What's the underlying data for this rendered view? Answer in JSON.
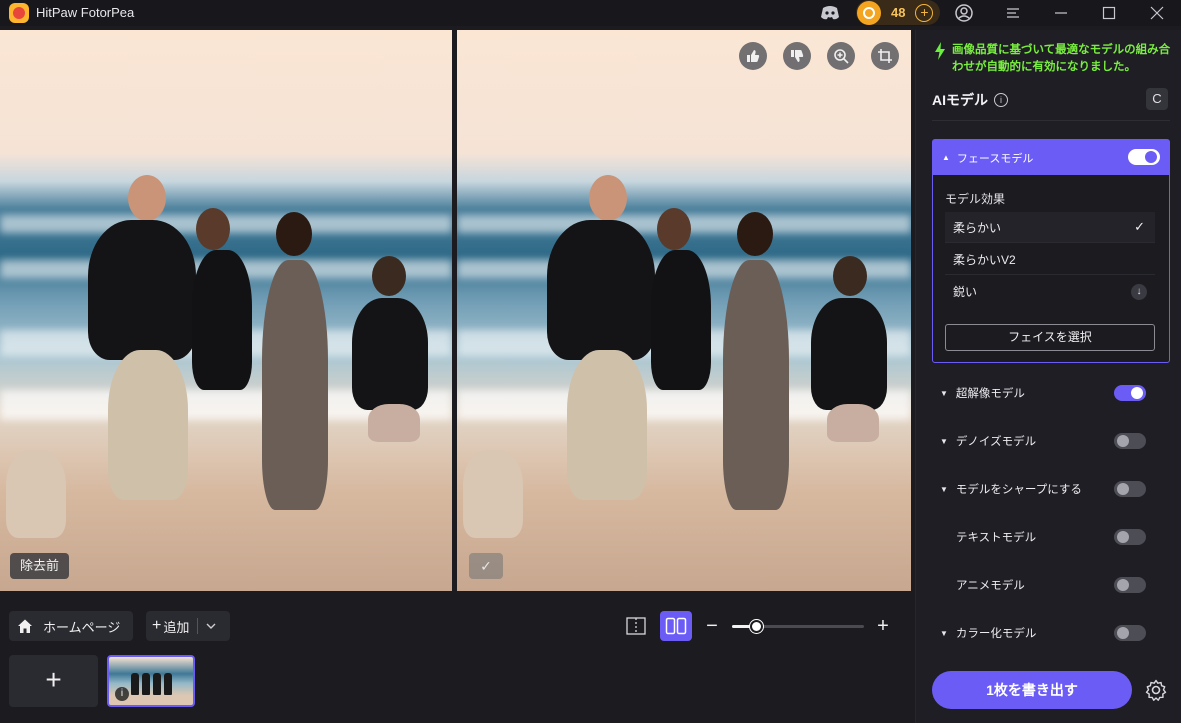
{
  "app": {
    "title": "HitPaw FotorPea",
    "coins": "48"
  },
  "titlebar_icons": [
    "discord-icon",
    "add-coins-icon",
    "account-icon",
    "menu-icon",
    "minimize-icon",
    "maximize-icon",
    "close-icon"
  ],
  "preview": {
    "left_label": "除去前",
    "right_label": "✓",
    "tools": [
      "thumbs-up-icon",
      "thumbs-down-icon",
      "zoom-in-icon",
      "crop-icon"
    ]
  },
  "bottom": {
    "home_label": "ホームページ",
    "add_label": "追加",
    "add_tile": "+",
    "zoom_minus": "−",
    "zoom_plus": "+",
    "zoom_level": 0.18
  },
  "panel": {
    "notice": "画像品質に基づいて最適なモデルの組み合わせが自動的に有効になりました。",
    "ai_title": "AIモデル",
    "reset_icon": "C",
    "face_model": {
      "label": "フェースモデル",
      "enabled": true,
      "effect_label": "モデル効果",
      "options": [
        {
          "label": "柔らかい",
          "selected": true
        },
        {
          "label": "柔らかいV2",
          "selected": false
        },
        {
          "label": "鋭い",
          "selected": false,
          "download": true
        }
      ],
      "select_face": "フェイスを選択"
    },
    "models": [
      {
        "label": "超解像モデル",
        "enabled": true,
        "collapsible": true
      },
      {
        "label": "デノイズモデル",
        "enabled": false,
        "collapsible": true
      },
      {
        "label": "モデルをシャープにする",
        "enabled": false,
        "collapsible": true
      },
      {
        "label": "テキストモデル",
        "enabled": false,
        "collapsible": false
      },
      {
        "label": "アニメモデル",
        "enabled": false,
        "collapsible": false
      },
      {
        "label": "カラー化モデル",
        "enabled": false,
        "collapsible": true
      }
    ],
    "export_label": "1枚を書き出す"
  },
  "colors": {
    "accent": "#6b5cf6",
    "notice": "#79ee3f",
    "coin": "#f3a521"
  }
}
